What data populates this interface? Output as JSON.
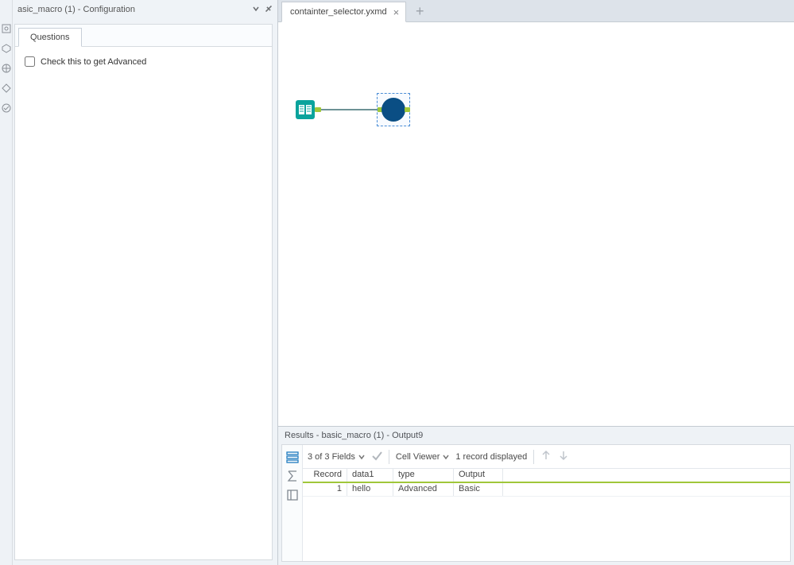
{
  "config": {
    "title": "asic_macro (1) - Configuration",
    "tab_label": "Questions",
    "checkbox_label": "Check this to get Advanced"
  },
  "document": {
    "tab_label": "containter_selector.yxmd"
  },
  "results": {
    "title": "Results - basic_macro (1) - Output9",
    "fields_text": "3 of 3 Fields",
    "cell_viewer_label": "Cell Viewer",
    "record_text": "1 record displayed",
    "columns": [
      "Record",
      "data1",
      "type",
      "Output"
    ],
    "rows": [
      {
        "record": "1",
        "data1": "hello",
        "type": "Advanced",
        "output": "Basic"
      }
    ]
  }
}
